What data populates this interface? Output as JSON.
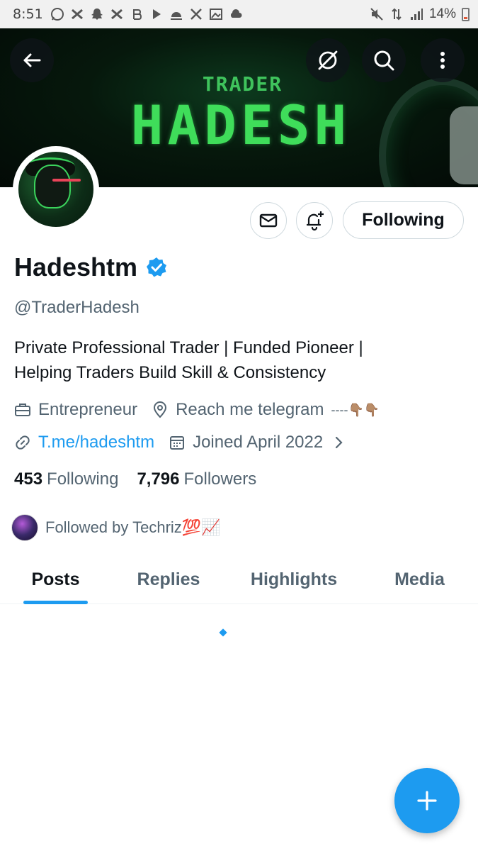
{
  "status_bar": {
    "time": "8:51",
    "battery": "14%",
    "left_icons": [
      "whatsapp-icon",
      "capcut-icon",
      "snapchat-icon",
      "capcut-icon",
      "bitcoin-icon",
      "play-icon",
      "weather-icon",
      "x-icon",
      "gallery-icon",
      "cloud-icon"
    ],
    "right_icons": [
      "mute-icon",
      "data-icon",
      "signal-icon",
      "battery-icon"
    ]
  },
  "banner": {
    "line1": "TRADER",
    "line2": "HADESH",
    "colors": {
      "text": "#3fdd5a",
      "background": "#06180c"
    }
  },
  "header_buttons": [
    "back-arrow-icon",
    "grok-icon",
    "search-icon",
    "more-vertical-icon"
  ],
  "profile": {
    "name": "Hadeshtm",
    "verified": true,
    "handle": "@TraderHadesh",
    "bio_line1": "Private Professional Trader | Funded Pioneer |",
    "bio_line2": "Helping Traders Build Skill & Consistency",
    "category": "Entrepreneur",
    "location": "Reach me telegram",
    "location_suffix": "----👇🏽👇🏽",
    "website": "T.me/hadeshtm",
    "joined": "Joined April 2022",
    "following_count": "453",
    "following_label": "Following",
    "followers_count": "7,796",
    "followers_label": "Followers",
    "followed_by": "Followed by Techriz💯📈"
  },
  "actions": {
    "follow_label": "Following"
  },
  "tabs": [
    {
      "label": "Posts",
      "active": true
    },
    {
      "label": "Replies",
      "active": false
    },
    {
      "label": "Highlights",
      "active": false
    },
    {
      "label": "Media",
      "active": false
    }
  ],
  "colors": {
    "accent": "#1d9bf0",
    "text": "#0f1419",
    "secondary": "#536471"
  }
}
